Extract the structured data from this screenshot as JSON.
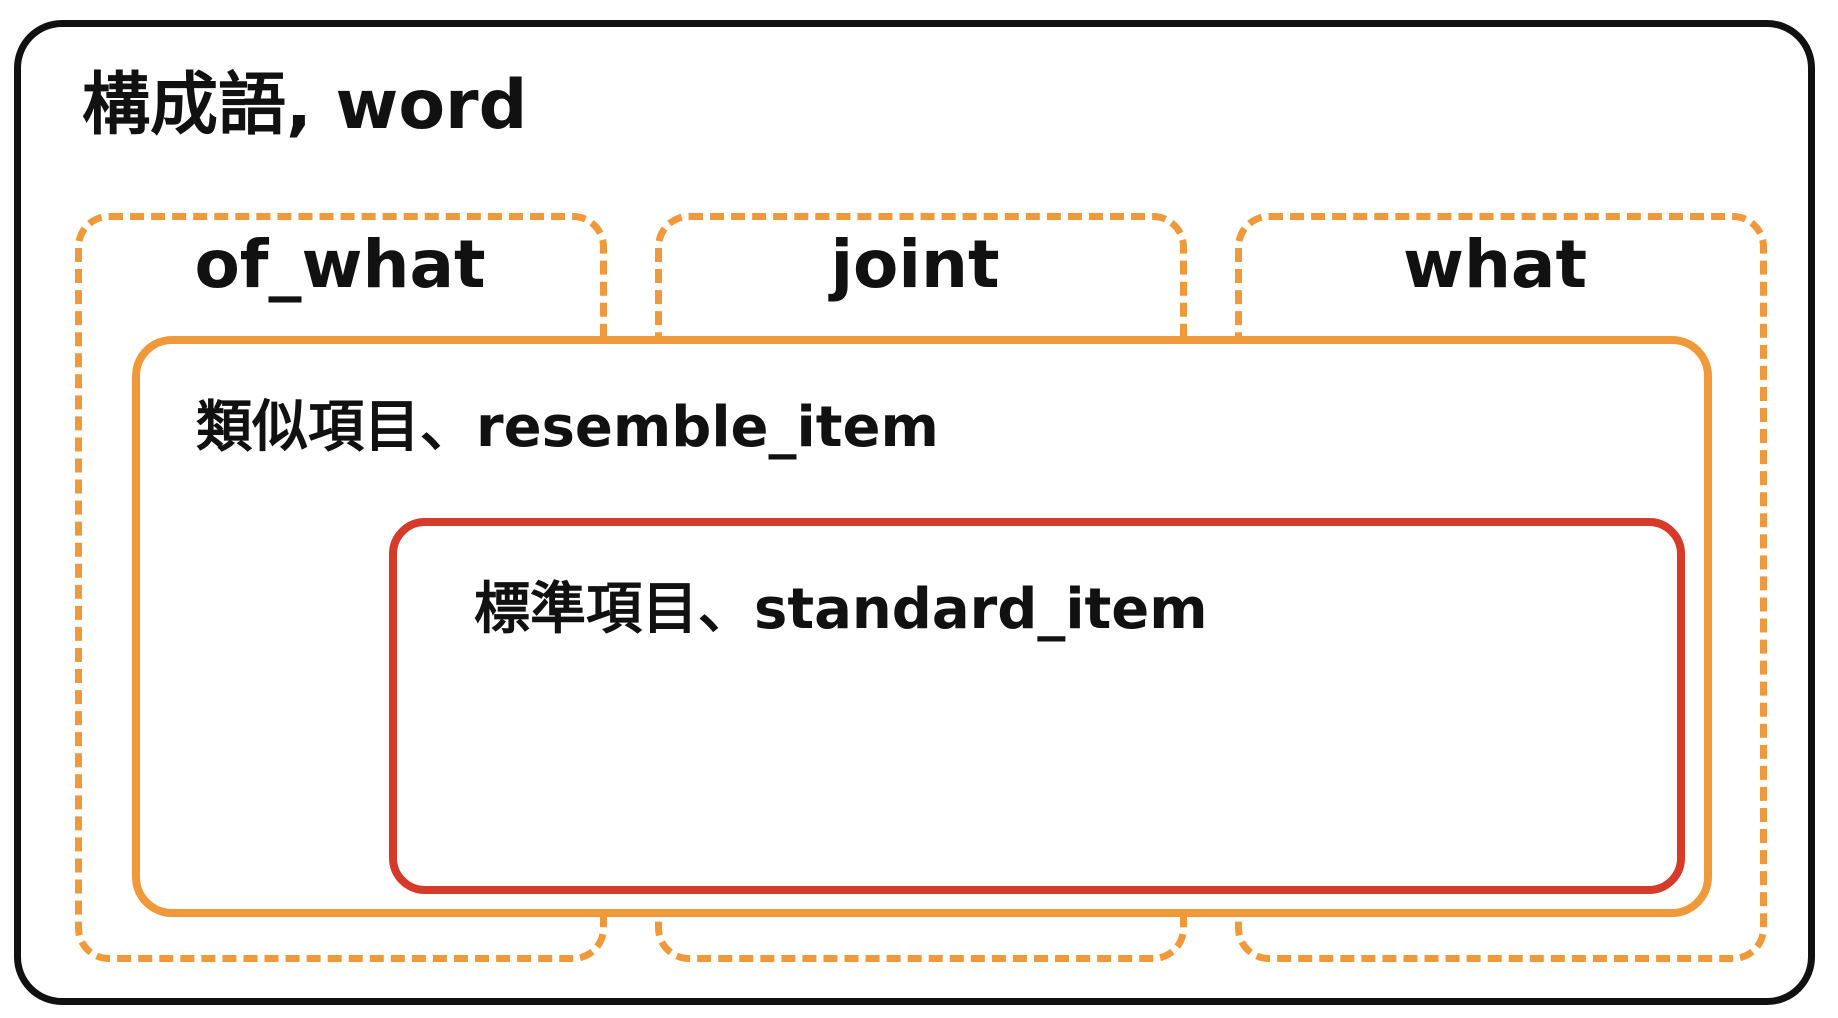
{
  "title": "構成語, word",
  "columns": [
    {
      "label": "of_what"
    },
    {
      "label": "joint"
    },
    {
      "label": "what"
    }
  ],
  "resemble_item": {
    "label": "類似項目、resemble_item"
  },
  "standard_item": {
    "label": "標準項目、standard_item"
  },
  "colors": {
    "outer_border": "#111111",
    "dashed_border": "#f0993a",
    "resemble_border": "#f0993a",
    "standard_border": "#d63a2a"
  }
}
